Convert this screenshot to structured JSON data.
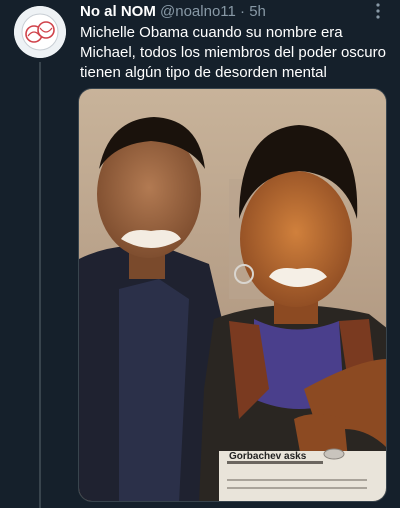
{
  "tweet": {
    "author_name": "No al NOM",
    "author_handle": "@noalno11",
    "separator": "·",
    "time": "5h",
    "text": "Michelle Obama cuando su nombre era Michael, todos los miembros del poder oscuro tienen algún tipo de desorden mental",
    "avatar_icon": "baseball-logo-icon",
    "more_icon": "more-vertical-icon"
  },
  "media": {
    "newspaper_headline": "Gorbachev asks"
  },
  "colors": {
    "background": "#15202b",
    "text_primary": "#ffffff",
    "text_secondary": "#8899a6",
    "divider": "#38444d"
  }
}
